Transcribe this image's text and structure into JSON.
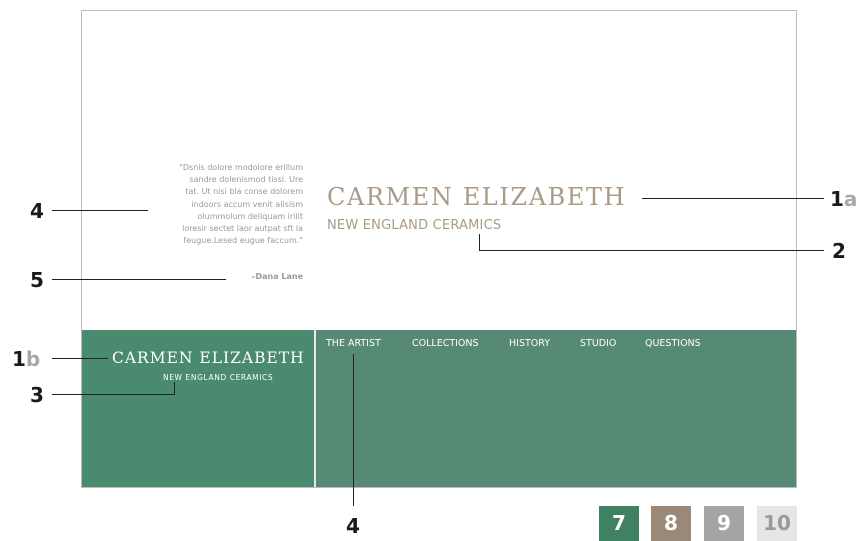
{
  "quote": {
    "lines": [
      "\"Dsnis dolore modolore erillum",
      "sandre dolenismod tissi. Ure",
      "tat. Ut nisi bla conse dolorem",
      "indoors accum venit alisism",
      "olummolum deliquam irilit",
      "loresir sectet laor autpat sft la",
      "feugue.Lesed eugue faccum.\""
    ],
    "author": "–Dana Lane"
  },
  "brand": {
    "name": "CARMEN ELIZABETH",
    "tagline": "NEW ENGLAND CERAMICS"
  },
  "band": {
    "name": "CARMEN ELIZABETH",
    "tagline": "NEW ENGLAND CERAMICS"
  },
  "nav": [
    "THE ARTIST",
    "COLLECTIONS",
    "HISTORY",
    "STUDIO",
    "QUESTIONS"
  ],
  "callouts": {
    "c1a": {
      "num": "1",
      "suffix": "a"
    },
    "c1b": {
      "num": "1",
      "suffix": "b"
    },
    "c2": "2",
    "c3": "3",
    "c4_left": "4",
    "c4_bottom": "4",
    "c5": "5"
  },
  "swatches": [
    {
      "label": "7",
      "color": "#3f8160"
    },
    {
      "label": "8",
      "color": "#9a8878"
    },
    {
      "label": "9",
      "color": "#a4a4a6"
    },
    {
      "label": "10",
      "color": "#e6e6e6"
    }
  ]
}
